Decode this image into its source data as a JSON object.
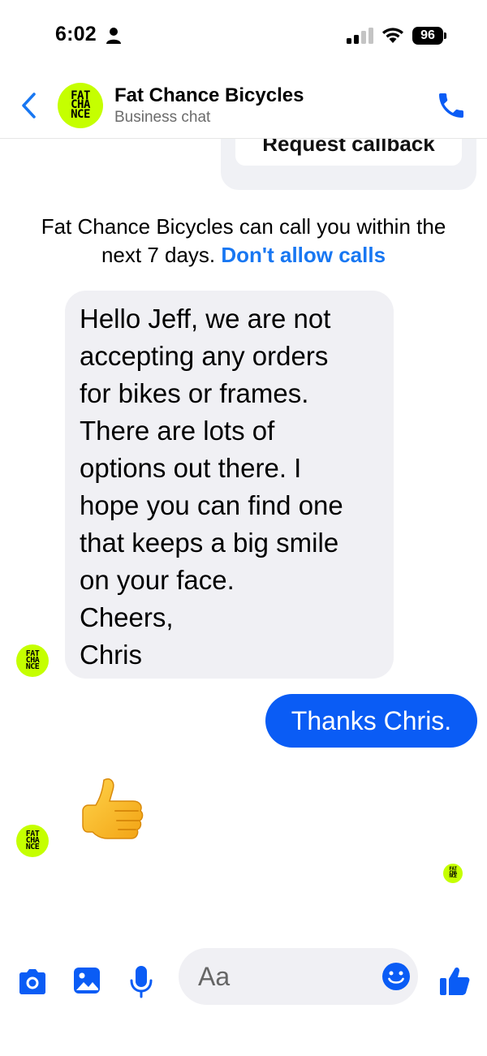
{
  "status_bar": {
    "time": "6:02",
    "battery": "96"
  },
  "header": {
    "logo_text": "FAT\nCHA\nNCE",
    "name": "Fat Chance Bicycles",
    "subtitle": "Business chat"
  },
  "previous_card": {
    "button_label": "Request callback"
  },
  "system_notice": {
    "text": "Fat Chance Bicycles can call you within the next 7 days. ",
    "link_label": "Don't allow calls"
  },
  "messages": [
    {
      "from": "business",
      "text": "Hello Jeff, we are not\naccepting any orders\nfor bikes or frames.\nThere are lots of\noptions out there. I\nhope you can find one\nthat keeps a big smile\non your face.\nCheers,\nChris"
    },
    {
      "from": "me",
      "text": "Thanks Chris."
    },
    {
      "from": "business",
      "emoji": "thumbs-up"
    }
  ],
  "composer": {
    "placeholder": "Aa"
  },
  "colors": {
    "brand_blue": "#0a5cf5",
    "link_blue": "#1877f2",
    "logo_lime": "#c5ff00",
    "bubble_gray": "#f0f0f4"
  },
  "icons": [
    "back-chevron-icon",
    "phone-icon",
    "camera-icon",
    "gallery-icon",
    "microphone-icon",
    "emoji-smile-icon",
    "thumbs-up-icon"
  ]
}
